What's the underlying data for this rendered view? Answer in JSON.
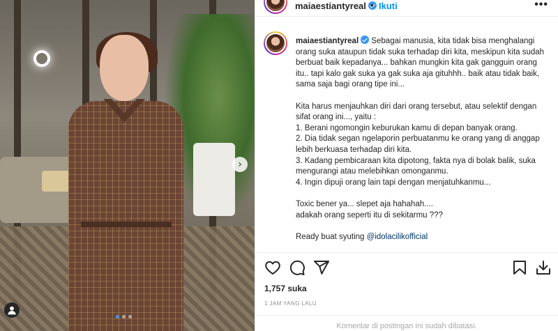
{
  "post": {
    "username": "maiaestiantyreal",
    "follow_label": "Ikuti",
    "more_label": "•••",
    "dot_separator": "•",
    "verified": true
  },
  "media": {
    "next_arrow": "›",
    "slide_count": 3,
    "active_slide": 1
  },
  "caption": {
    "author": "maiaestiantyreal",
    "para1": "Sebagai manusia, kita tidak bisa menghalangi orang suka ataupun tidak suka terhadap diri kita, meskipun kita sudah berbuat baik kepadanya... bahkan mungkin kita gak gangguin orang itu.. tapi kalo gak suka ya gak suka aja gituhhh.. baik atau tidak baik, sama saja bagi orang tipe ini...",
    "para2_intro": "Kita harus menjauhkan diri dari orang tersebut, atau selektif dengan sifat orang ini..., yaitu :",
    "list": [
      "1. Berani ngomongin keburukan kamu di depan banyak orang.",
      "2. Dia tidak segan ngelaporin perbuatanmu ke orang yang di anggap lebih berkuasa terhadap diri kita.",
      "3. Kadang pembicaraan kita dipotong, fakta nya di bolak balik, suka mengurangi atau melebihkan omonganmu.",
      "4. Ingin dipuji orang lain tapi dengan menjatuhkanmu..."
    ],
    "para3_line1": "Toxic bener ya... slepet aja hahahah....",
    "para3_line2": "adakah orang seperti itu di sekitarmu ???",
    "ready_text": "Ready buat syuting ",
    "mention": "@idolacilikofficial"
  },
  "actions": {
    "icons": [
      "heart-icon",
      "comment-icon",
      "share-icon",
      "bookmark-icon",
      "download-icon"
    ]
  },
  "likes_text": "1,757 suka",
  "time_ago": "1 JAM YANG LALU",
  "comments_disabled": "Komentar di postingan ini sudah dibatasi."
}
